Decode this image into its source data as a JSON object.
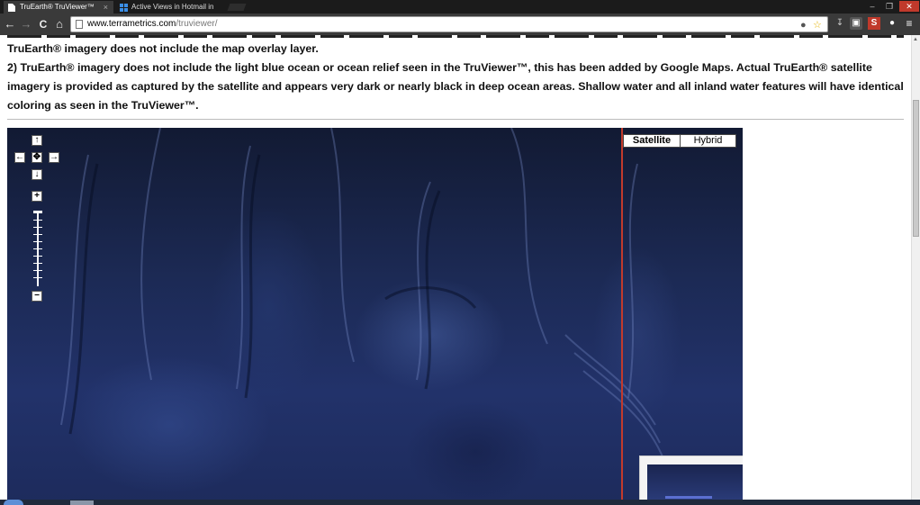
{
  "browser": {
    "tabs": [
      {
        "title": "TruEarth® TruViewer™",
        "active": true,
        "close": "×"
      },
      {
        "title": "Active Views in Hotmail in",
        "active": false,
        "close": "×"
      }
    ],
    "url": {
      "host": "www.terrametrics.com",
      "path": "/truviewer/"
    },
    "nav": {
      "back": "←",
      "forward": "→",
      "reload": "C",
      "home": "⌂"
    },
    "window_controls": {
      "minimize": "–",
      "restore": "❐",
      "close": "✕"
    }
  },
  "page": {
    "partial_line": "TruEarth® imagery does not include the map overlay layer.",
    "note2": "2) TruEarth® imagery does not include the light blue ocean or ocean relief seen in the TruViewer™, this has been added by Google Maps. Actual TruEarth® satellite imagery is provided as captured by the satellite and appears very dark or nearly black in deep ocean areas. Shallow water and all inland water features will have identical coloring as seen in the TruViewer™."
  },
  "map": {
    "controls": {
      "pan_up": "↑",
      "pan_left": "←",
      "pan_center": "✥",
      "pan_right": "→",
      "pan_down": "↓",
      "zoom_in": "+",
      "zoom_out": "−"
    },
    "map_types": [
      {
        "label": "Satellite",
        "selected": true
      },
      {
        "label": "Hybrid",
        "selected": false
      }
    ]
  },
  "colors": {
    "divider": "#c23a2c",
    "ocean": "#1c2a55"
  }
}
